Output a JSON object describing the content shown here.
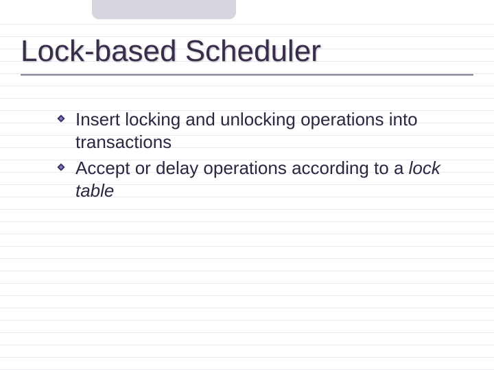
{
  "title": "Lock-based Scheduler",
  "bullets": [
    {
      "text_a": "Insert locking and unlocking operations into transactions",
      "italic_b": ""
    },
    {
      "text_a": "Accept or delay operations according to a ",
      "italic_b": "lock table"
    }
  ],
  "colors": {
    "title": "#3a2d4a",
    "body": "#2d2640",
    "rule": "#e9e9ef",
    "tab": "#d6d6de",
    "bullet_outer": "#3a2d6a",
    "bullet_inner": "#7a6aa0"
  }
}
